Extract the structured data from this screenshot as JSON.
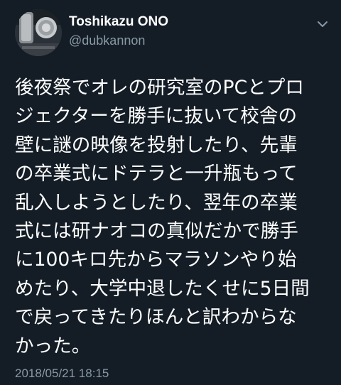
{
  "author": {
    "name": "Toshikazu ONO",
    "handle": "@dubkannon"
  },
  "menu_icon": "chevron-down-icon",
  "tweet": {
    "lines": [
      "後夜祭でオレの研究室のPCとプロ",
      "ジェクターを勝手に抜いて校舎の",
      "壁に謎の映像を投射したり、先輩",
      "の卒業式にドテラと一升瓶もって",
      "乱入しようとしたり、翌年の卒業",
      "式には研ナオコの真似だかで勝手",
      "に100キロ先からマラソンやり始",
      "めたり、大学中退したくせに5日間",
      "で戻ってきたりほんと訳わからな",
      "かった。"
    ]
  },
  "timestamp": "2018/05/21 18:15",
  "colors": {
    "background": "#141d26",
    "text": "#ffffff",
    "secondary_text": "#8899a6"
  }
}
